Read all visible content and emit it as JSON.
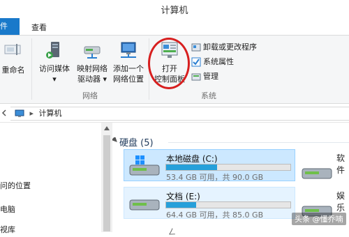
{
  "window": {
    "title": "计算机"
  },
  "menu": {
    "file_tab": "件",
    "view_tab": "查看"
  },
  "ribbon": {
    "rename_label": "重命名",
    "network_group": {
      "label": "网络",
      "buttons": [
        {
          "label1": "访问媒体",
          "label2": "▾"
        },
        {
          "label1": "映射网络",
          "label2": "驱动器 ▾"
        },
        {
          "label1": "添加一个",
          "label2": "网络位置"
        }
      ]
    },
    "system_group": {
      "label": "系统",
      "open_control_panel": {
        "label1": "打开",
        "label2": "控制面板"
      },
      "small_items": [
        "卸载或更改程序",
        "系统属性",
        "管理"
      ]
    }
  },
  "address": {
    "path": "计算机",
    "separator": "▸"
  },
  "nav": {
    "items": [
      "问的位置",
      "电脑",
      "视库"
    ]
  },
  "content": {
    "section": "硬盘 (5)",
    "drives": [
      {
        "name": "本地磁盘 (C:)",
        "info": "53.4 GB 可用，共 90.0 GB",
        "used_fraction": 0.41
      },
      {
        "name": "文档 (E:)",
        "info": "64.4 GB 可用，共 85.0 GB",
        "used_fraction": 0.24
      }
    ],
    "side_labels": [
      "软件",
      "娱乐"
    ],
    "partial_label": "ㄥ"
  },
  "watermark": "头条 @懂乔喃",
  "colors": {
    "accent": "#1979ca",
    "progress": "#26a0da",
    "highlight": "#d71f1f"
  }
}
